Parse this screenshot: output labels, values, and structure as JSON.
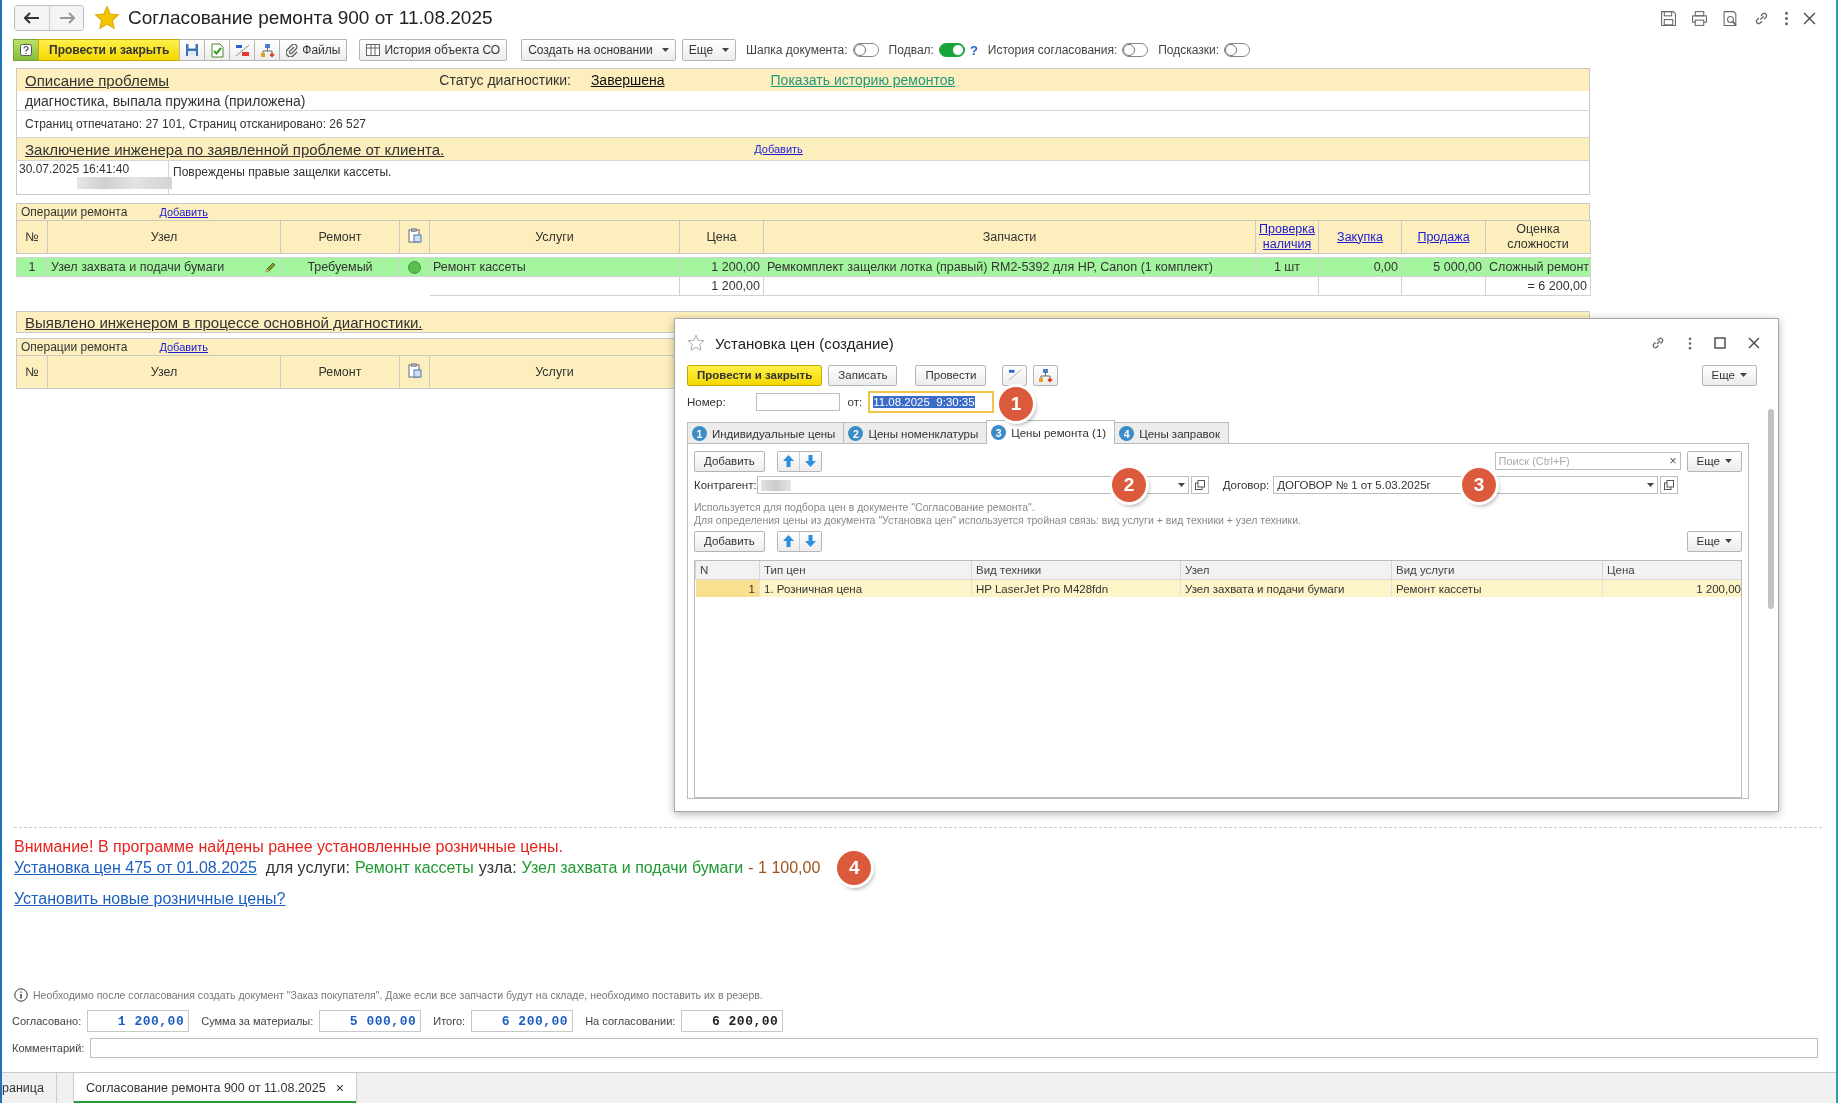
{
  "window": {
    "title": "Согласование ремонта 900 от 11.08.2025",
    "favorite": true
  },
  "toolbar": {
    "primary": "Провести и закрыть",
    "files": "Файлы",
    "history": "История объекта СО",
    "create_based": "Создать на основании",
    "more": "Еще",
    "toggles": [
      {
        "label": "Шапка документа:",
        "on": false
      },
      {
        "label": "Подвал:",
        "on": true,
        "help": "?"
      },
      {
        "label": "История согласования:",
        "on": false
      },
      {
        "label": "Подсказки:",
        "on": false
      }
    ]
  },
  "problem": {
    "title": "Описание проблемы",
    "status_label": "Статус диагностики:",
    "status": "Завершена",
    "history_link": "Показать историю ремонтов",
    "description": "диагностика, выпала пружина (приложена)",
    "pages": "Страниц отпечатано: 27 101, Страниц отсканировано: 26 527"
  },
  "conclusion": {
    "title": "Заключение инженера по заявленной проблеме от клиента.",
    "add": "Добавить",
    "entries": [
      {
        "datetime": "30.07.2025 16:41:40",
        "text": "Повреждены правые защелки кассеты."
      }
    ]
  },
  "operations": {
    "caption": "Операции ремонта",
    "add": "Добавить",
    "columns": [
      {
        "kind": "text",
        "label": "№"
      },
      {
        "kind": "text",
        "label": "Узел"
      },
      {
        "kind": "text",
        "label": "Ремонт"
      },
      {
        "kind": "icon"
      },
      {
        "kind": "text",
        "label": "Услуги"
      },
      {
        "kind": "text",
        "label": "Цена"
      },
      {
        "kind": "text",
        "label": "Запчасти"
      },
      {
        "kind": "link",
        "label": "Проверка наличия"
      },
      {
        "kind": "link",
        "label": "Закупка"
      },
      {
        "kind": "link",
        "label": "Продажа"
      },
      {
        "kind": "text",
        "label": "Оценка сложности"
      }
    ],
    "rows": [
      {
        "number": "1",
        "node": "Узел захвата и подачи бумаги",
        "repair": "Требуемый",
        "color": "#5cc04e",
        "service": "Ремонт кассеты",
        "price": "1 200,00",
        "parts": "Ремкомплект защелки лотка (правый) RM2-5392 для HP, Canon (1 комплект)",
        "stock": "1 шт",
        "purchase": "0,00",
        "sale": "5 000,00",
        "complexity": "Сложный ремонт",
        "selected": true
      }
    ],
    "totals": {
      "price": "1 200,00",
      "total": "= 6 200,00"
    }
  },
  "found": {
    "title": "Выявлено инженером в процессе основной диагностики.",
    "operations": {
      "caption": "Операции ремонта",
      "add": "Добавить",
      "columns": [
        {
          "kind": "text",
          "label": "№"
        },
        {
          "kind": "text",
          "label": "Узел"
        },
        {
          "kind": "text",
          "label": "Ремонт"
        },
        {
          "kind": "icon"
        },
        {
          "kind": "text",
          "label": "Услуги"
        }
      ]
    }
  },
  "dialog": {
    "title": "Установка цен (создание)",
    "favorite": false,
    "buttons": [
      {
        "kind": "primary",
        "label": "Провести и закрыть"
      },
      {
        "kind": "plain",
        "label": "Записать"
      },
      {
        "kind": "plain",
        "label": "Провести"
      }
    ],
    "more": "Еще",
    "number_label": "Номер:",
    "date_label": "от:",
    "date": "11.08.2025  9:30:35",
    "date_marker": "1",
    "tabs": [
      {
        "number": "1",
        "label": "Индивидуальные цены",
        "selected": false
      },
      {
        "number": "2",
        "label": "Цены номенклатуры",
        "selected": false
      },
      {
        "number": "3",
        "label": "Цены ремонта (1)",
        "selected": true
      },
      {
        "number": "4",
        "label": "Цены заправок",
        "selected": false
      }
    ],
    "add": "Добавить",
    "search_placeholder": "Поиск (Ctrl+F)",
    "search_clear": "×",
    "search_more": "Еще",
    "contractor_label": "Контрагент:",
    "contractor_marker": "2",
    "contract_label": "Договор:",
    "contract": "ДОГОВОР № 1 от 5.03.2025г",
    "contract_marker": "3",
    "hints": [
      "Используется для подбора цен в документе \"Согласование ремонта\".",
      "Для определения цены из документа \"Установка цен\" используется тройная связь: вид услуги + вид техники + узел техники."
    ],
    "table_add": "Добавить",
    "table_more": "Еще",
    "table": {
      "columns": [
        "N",
        "Тип цен",
        "Вид техники",
        "Узел",
        "Вид услуги",
        "Цена"
      ],
      "rows": [
        {
          "number": "1",
          "price_type": "1. Розничная цена",
          "device": "HP LaserJet Pro M428fdn",
          "node": "Узел захвата и подачи бумаги",
          "service": "Ремонт кассеты",
          "price": "1 200,00",
          "selected": true
        }
      ]
    }
  },
  "warning": {
    "text": "Внимание! В программе найдены ранее установленные розничные цены.",
    "link": "Установка цен 475 от 01.08.2025",
    "for_service": "для услуги:",
    "service": "Ремонт кассеты",
    "node_label": "узла:",
    "node": "Узел захвата и подачи бумаги",
    "price": "- 1 100,00",
    "marker": "4",
    "action": "Установить новые розничные цены?"
  },
  "footer": {
    "info": "Необходимо после согласования создать документ \"Заказ покупателя\". Даже если все запчасти будут на складе, необходимо поставить их в резерв.",
    "totals": [
      {
        "label": "Согласовано:",
        "value": "1 200,00",
        "kind": "accent"
      },
      {
        "label": "Сумма за материалы:",
        "value": "5 000,00",
        "kind": "accent"
      },
      {
        "label": "Итого:",
        "value": "6 200,00",
        "kind": "accent"
      },
      {
        "label": "На согласовании:",
        "value": "6 200,00",
        "kind": "plain"
      }
    ],
    "comment_label": "Комментарий:"
  },
  "open_tabs": [
    {
      "label": "раница",
      "selected": false
    },
    {
      "label": "Согласование ремонта 900 от 11.08.2025",
      "selected": true,
      "close": "×"
    }
  ]
}
